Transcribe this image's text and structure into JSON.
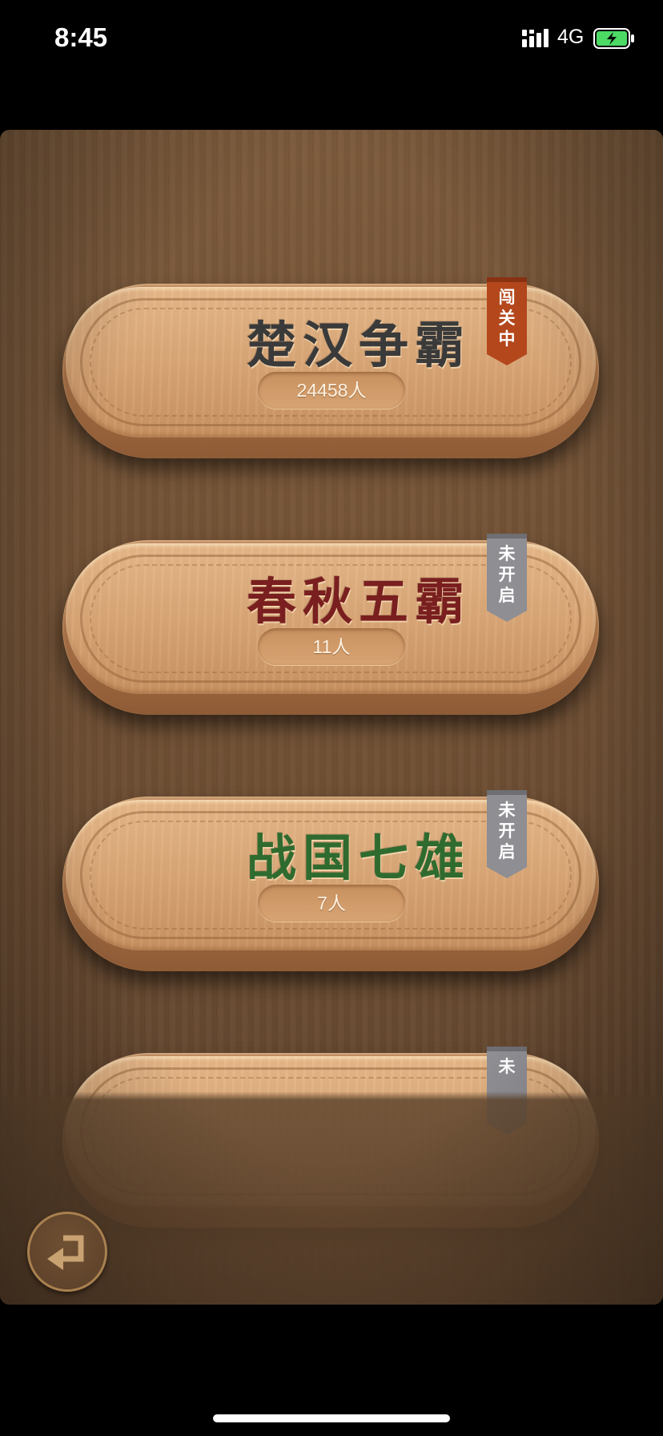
{
  "status_bar": {
    "time": "8:45",
    "network": "4G",
    "signal_icon": "signal-bars-icon",
    "battery_icon": "battery-charging-icon",
    "battery_color": "#4cd964"
  },
  "levels": [
    {
      "title": "楚汉争霸",
      "players": "24458人",
      "badge": [
        "闯",
        "关",
        "中"
      ],
      "title_color": "#3a3a3a",
      "badge_color": "#b4471c"
    },
    {
      "title": "春秋五霸",
      "players": "11人",
      "badge": [
        "未",
        "开",
        "启"
      ],
      "title_color": "#7a1f1f",
      "badge_color": "#8e8e93"
    },
    {
      "title": "战国七雄",
      "players": "7人",
      "badge": [
        "未",
        "开",
        "启"
      ],
      "title_color": "#2f6b2f",
      "badge_color": "#8e8e93"
    },
    {
      "badge": [
        "未"
      ],
      "badge_color": "#8e8e93"
    }
  ],
  "back_button_icon": "return-arrow-icon"
}
